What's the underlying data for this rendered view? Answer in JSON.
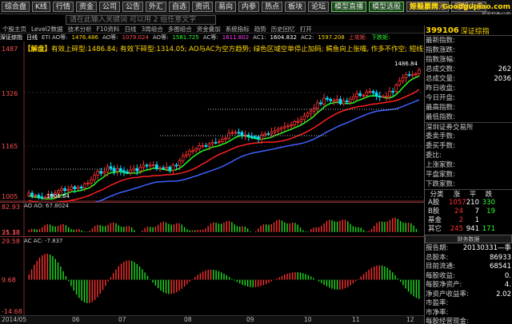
{
  "toolbar": {
    "buttons": [
      "综合盘",
      "K线",
      "行情",
      "资金",
      "公司",
      "公告",
      "外汇",
      "自选",
      "资讯",
      "易向",
      "内参",
      "热点",
      "板块",
      "论坛"
    ],
    "green_buttons": [
      "模型直播",
      "模型选股"
    ],
    "extra_buttons": [
      "策略股票池",
      "理想内参"
    ],
    "logo": "好股票网",
    "logo_sub": "Goodgupiao.com",
    "logo_small": "易股软件公司"
  },
  "search": {
    "placeholder": "请在此输入关键词   可以用 2 组任意文字"
  },
  "tabs": [
    "个股主页",
    "Level2数据",
    "技术分析",
    "F10资料",
    "日线",
    "3周组合",
    "多图组合",
    "资金叠加",
    "系统指标",
    "趋势",
    "历史回忆",
    "打开"
  ],
  "info_line": {
    "name": "深证综指",
    "period": "日线",
    "ma_label": "ETI AO等:",
    "ma5": "1476.486",
    "ma10_label": "AO等:",
    "ma10": "1079.024",
    "ma20_label": "AO等:",
    "ma20": "1581.725",
    "ma30_label": "AC等:",
    "ma30": "1611.802",
    "ma60_label": "AC1:",
    "ma60": "1604.832",
    "ma120_label": "AC2:",
    "ma120": "1597.208",
    "up_label": "上攻矩:",
    "down_label": "下跌矩:"
  },
  "strategy": {
    "tag": "【解盘】",
    "text": "有效上碎型:1486.84; 有效下碎型:1314.05; AO与AC为空方趋势; 绿色区域空单停止加码; 鳄鱼向上张嘴, 作多不作空; 短线多头"
  },
  "main_axis": [
    "1487",
    "1326",
    "1165",
    "1005"
  ],
  "price_marks": [
    "1486.84",
    "1006.64"
  ],
  "vol_panel": {
    "label": "AO AO: 67.8024",
    "axis": [
      "82.93",
      "25.38",
      "31.18"
    ]
  },
  "macd_panel": {
    "label": "AC AC: -7.837",
    "axis": [
      "29.58",
      "9.68",
      "-14.68"
    ]
  },
  "dates": [
    "2014/05",
    "06",
    "07",
    "08",
    "09",
    "10",
    "11",
    "12"
  ],
  "right_panel": {
    "code": "399106",
    "name": "深证综指",
    "rows": [
      {
        "k": "最新指数:",
        "v": ""
      },
      {
        "k": "指数涨跌:",
        "v": ""
      },
      {
        "k": "指数涨幅:",
        "v": ""
      },
      {
        "k": "总成交数:",
        "v": "262"
      },
      {
        "k": "总成交量:",
        "v": "2036"
      },
      {
        "k": "昨日收盘:",
        "v": ""
      },
      {
        "k": "今日开盘:",
        "v": ""
      },
      {
        "k": "最高指数:",
        "v": ""
      },
      {
        "k": "最低指数:",
        "v": ""
      }
    ],
    "exchange": "深圳证券交易所",
    "exchange_rows": [
      {
        "k": "委卖手数:",
        "v": ""
      },
      {
        "k": "委买手数:",
        "v": ""
      },
      {
        "k": "委比:",
        "v": ""
      },
      {
        "k": "上涨家数:",
        "v": ""
      },
      {
        "k": "平盘家数:",
        "v": ""
      },
      {
        "k": "下跌家数:",
        "v": ""
      }
    ],
    "cat_header": [
      "分类",
      "涨",
      "平",
      "跌"
    ],
    "cat_rows": [
      {
        "name": "A股",
        "up": "1057",
        "flat": "210",
        "down": "330"
      },
      {
        "name": "B股",
        "up": "24",
        "flat": "7",
        "down": "19"
      },
      {
        "name": "基金",
        "up": "2",
        "flat": "1",
        "down": ""
      },
      {
        "name": "其它",
        "up": "245",
        "flat": "941",
        "down": "171"
      }
    ],
    "fin_button": "财务数据",
    "fin_rows": [
      {
        "k": "报告期:",
        "v": "20130331—季"
      },
      {
        "k": "总股本:",
        "v": "86933"
      },
      {
        "k": "目前流通:",
        "v": "68541"
      },
      {
        "k": "每股收益:",
        "v": "0."
      },
      {
        "k": "每股净资产:",
        "v": "4."
      },
      {
        "k": "净资产收益率:",
        "v": "2.02"
      },
      {
        "k": "市盈率:",
        "v": ""
      },
      {
        "k": "市净率:",
        "v": ""
      },
      {
        "k": "每股经营现金:",
        "v": ""
      }
    ]
  },
  "colors": {
    "up": "#ff3030",
    "down": "#00ffff",
    "ma_red": "#ff2020",
    "ma_green": "#20ff20",
    "ma_blue": "#4060ff",
    "accent": "#ffd800"
  }
}
